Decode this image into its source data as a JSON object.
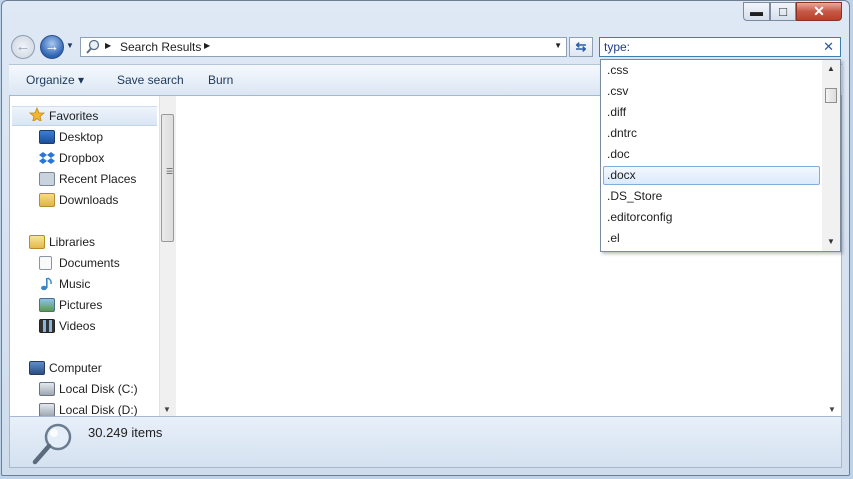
{
  "window": {
    "controls": {
      "minimize": "▬",
      "maximize": "□",
      "close": "✕"
    }
  },
  "nav": {
    "back_glyph": "←",
    "forward_glyph": "→",
    "recent_glyph": "▼"
  },
  "address": {
    "crumb": "Search Results",
    "separator": "▶",
    "dropdown_glyph": "▼"
  },
  "refresh_glyph": "⇆",
  "search": {
    "value": "type:",
    "clear_glyph": "✕"
  },
  "toolbar": {
    "organize": "Organize",
    "organize_arrow": "▾",
    "save_search": "Save search",
    "burn": "Burn"
  },
  "sidebar": {
    "favorites": {
      "label": "Favorites",
      "items": [
        "Desktop",
        "Dropbox",
        "Recent Places",
        "Downloads"
      ]
    },
    "libraries": {
      "label": "Libraries",
      "items": [
        "Documents",
        "Music",
        "Pictures",
        "Videos"
      ]
    },
    "computer": {
      "label": "Computer",
      "items": [
        "Local Disk (C:)",
        "Local Disk (D:)"
      ]
    }
  },
  "scroll_glyphs": {
    "up": "▲",
    "down": "▼",
    "grip": "☰"
  },
  "status": {
    "count": "30.249 items"
  },
  "suggestions": {
    "items": [
      ".css",
      ".csv",
      ".diff",
      ".dntrc",
      ".doc",
      ".docx",
      ".DS_Store",
      ".editorconfig",
      ".el"
    ],
    "selected": ".docx"
  },
  "colors": {
    "accent": "#2d63b2",
    "selection_border": "#84acdd",
    "window_frame": "#cfdcec"
  },
  "icons": {
    "favorites": "star-icon",
    "desktop": "desktop-icon",
    "dropbox": "dropbox-icon",
    "recent_places": "recent-places-icon",
    "downloads": "downloads-folder-icon",
    "libraries": "libraries-icon",
    "documents": "documents-icon",
    "music": "music-icon",
    "pictures": "pictures-icon",
    "videos": "videos-icon",
    "computer": "computer-icon",
    "local_disk": "disk-drive-icon",
    "search": "magnifier-icon"
  }
}
